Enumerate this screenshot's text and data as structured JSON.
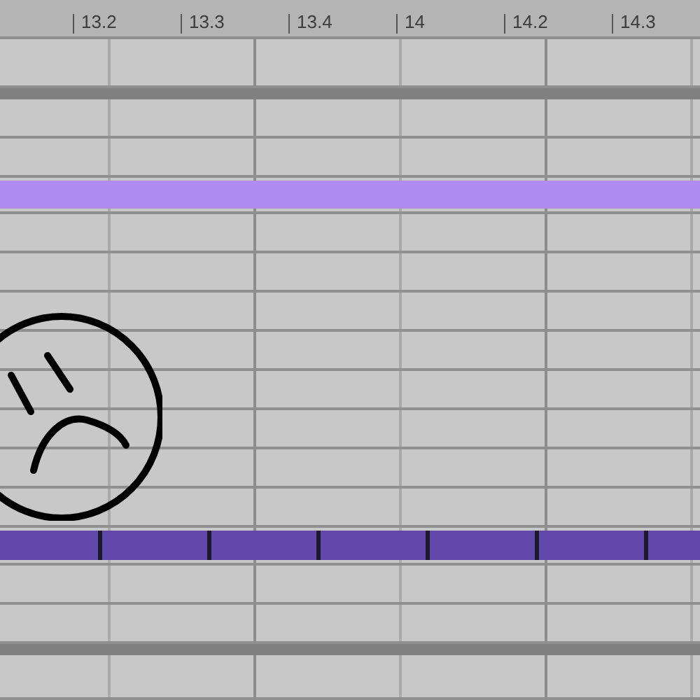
{
  "ruler": {
    "labels": [
      "13.2",
      "13.3",
      "13.4",
      "14",
      "14.2",
      "14.3"
    ]
  },
  "lanes": [
    {
      "kind": "empty"
    },
    {
      "kind": "separator"
    },
    {
      "kind": "empty"
    },
    {
      "kind": "empty"
    },
    {
      "kind": "clip",
      "color": "#b08cf2"
    },
    {
      "kind": "empty"
    },
    {
      "kind": "empty"
    },
    {
      "kind": "empty"
    },
    {
      "kind": "empty"
    },
    {
      "kind": "empty"
    },
    {
      "kind": "empty"
    },
    {
      "kind": "empty"
    },
    {
      "kind": "empty"
    },
    {
      "kind": "clip",
      "color": "#6248aa"
    },
    {
      "kind": "empty"
    },
    {
      "kind": "empty"
    },
    {
      "kind": "separator"
    },
    {
      "kind": "empty"
    }
  ]
}
